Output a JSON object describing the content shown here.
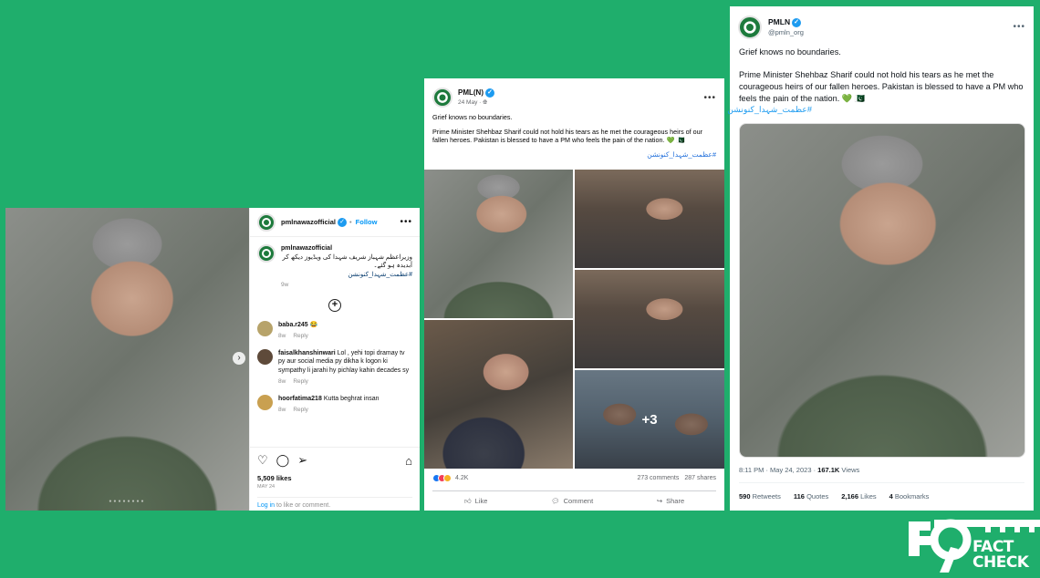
{
  "colors": {
    "background": "#1fae6c",
    "fb_blue": "#216fdb",
    "tw_blue": "#1d9bf0",
    "ig_blue": "#0095f6"
  },
  "instagram": {
    "username": "pmlnawazofficial",
    "follow_label": "Follow",
    "caption_username": "pmlnawazofficial",
    "caption": "وزیراعظم شہباز شریف شہدا کی ویڈیوز دیکھ کر آبدیدہ ہو گئے۔",
    "hashtag": "#عظمت_شہدا_کنونشن",
    "caption_time": "9w",
    "comments": [
      {
        "user": "baba.r245",
        "text": "😂",
        "time": "8w",
        "reply": "Reply"
      },
      {
        "user": "faisalkhanshinwari",
        "text": "Lol , yehi topi dramay tv py aur social media py dikha k logon ki sympathy li jarahi hy pichlay kahin decades sy",
        "time": "8w",
        "reply": "Reply"
      },
      {
        "user": "hoorfatima218",
        "text": "Kutta beghrat insan",
        "time": "8w",
        "reply": "Reply"
      }
    ],
    "likes": "5,509 likes",
    "date": "MAY 24",
    "login_link": "Log in",
    "login_text": " to like or comment."
  },
  "facebook": {
    "page_name": "PML(N)",
    "date": "24 May · ",
    "line1": "Grief knows no boundaries.",
    "line2": "Prime Minister Shehbaz Sharif could not hold his tears as he met the courageous heirs of our fallen heroes. Pakistan is blessed to have a PM who feels the pain of the nation. 💚 🇵🇰",
    "hashtag": "#عظمت_شہدا_کنونشن",
    "more_photos": "+3",
    "reactions_count": "4.2K",
    "comments": "273 comments",
    "shares": "287 shares",
    "like": "Like",
    "comment": "Comment",
    "share": "Share"
  },
  "twitter": {
    "name": "PMLN",
    "handle": "@pmln_org",
    "line1": "Grief knows no boundaries.",
    "line2": "Prime Minister Shehbaz Sharif could not hold his tears as he met the courageous heirs of our fallen heroes. Pakistan is blessed to have a PM who feels the pain of the nation. 💚 🇵🇰",
    "hashtag": "#عظمت_شہدا_کنونشن",
    "timestamp": "8:11 PM · May 24, 2023 · ",
    "views_count": "167.1K",
    "views_label": " Views",
    "retweets_count": "590",
    "retweets_label": " Retweets",
    "quotes_count": "116",
    "quotes_label": " Quotes",
    "likes_count": "2,166",
    "likes_label": " Likes",
    "bookmarks_count": "4",
    "bookmarks_label": " Bookmarks"
  },
  "watermark": {
    "line1": "FACT",
    "line2": "CHECK"
  }
}
